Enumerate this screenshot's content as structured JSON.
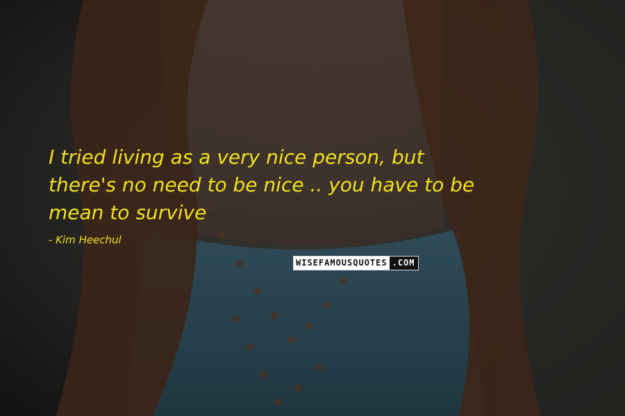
{
  "quote": {
    "lines": [
      "I tried living as a very nice person, but",
      "there's no need to be nice .. you have to be",
      "mean to survive"
    ],
    "author": "- Kim Heechul",
    "color": "#f2e21c"
  },
  "watermark": {
    "part1": "WISEFAMOUSQUOTES",
    "part2": ".COM"
  },
  "background": {
    "description_colors": {
      "top": "#262624",
      "dress": "#2a4551",
      "hair": "#3a2418"
    }
  }
}
